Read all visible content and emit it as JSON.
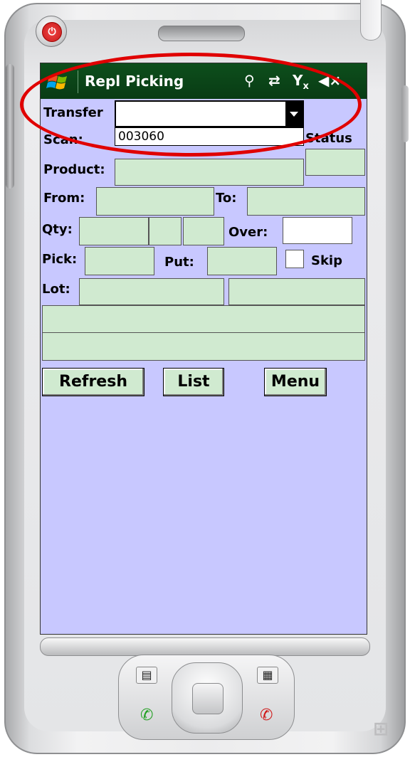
{
  "titlebar": {
    "app_title": "Repl Picking",
    "icons": [
      "windows-start-icon",
      "antenna-icon",
      "sync-icon",
      "no-signal-icon",
      "speaker-muted-icon"
    ]
  },
  "form": {
    "transfer_label": "Transfer",
    "transfer_value": "",
    "scan_label": "Scan:",
    "scan_value": "003060",
    "status_label": "Status",
    "product_label": "Product:",
    "from_label": "From:",
    "to_label": "To:",
    "qty_label": "Qty:",
    "over_label": "Over:",
    "pick_label": "Pick:",
    "put_label": "Put:",
    "skip_label": "Skip",
    "skip_checked": false,
    "lot_label": "Lot:"
  },
  "buttons": {
    "refresh": "Refresh",
    "list": "List",
    "menu": "Menu"
  },
  "colors": {
    "screen_bg": "#c8c8ff",
    "field_bg": "#d0ead0",
    "titlebar_bg": "#0d4f1c",
    "highlight_circle": "#e00000"
  }
}
